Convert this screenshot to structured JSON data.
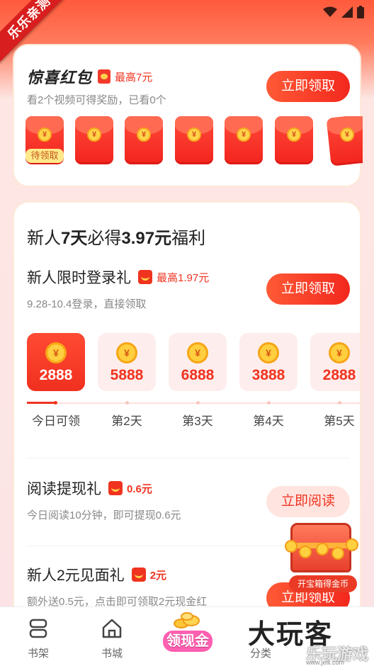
{
  "ribbon": {
    "text": "乐乐亲测"
  },
  "surprise": {
    "title": "惊喜红包",
    "max": "最高7元",
    "subtitle": "看2个视频可得奖励，已看0个",
    "button": "立即领取",
    "pending_tag": "待领取",
    "coin_symbol": "¥"
  },
  "newbie": {
    "title_prefix": "新人",
    "title_days": "7天",
    "title_mid": "必得",
    "title_amount": "3.97元",
    "title_suffix": "福利",
    "login": {
      "title": "新人限时登录礼",
      "max": "最高1.97元",
      "subtitle": "9.28-10.4登录，直接领取",
      "button": "立即领取"
    },
    "days": [
      {
        "amount": "2888",
        "label": "今日可领",
        "active": true
      },
      {
        "amount": "5888",
        "label": "第2天",
        "active": false
      },
      {
        "amount": "6888",
        "label": "第3天",
        "active": false
      },
      {
        "amount": "3888",
        "label": "第4天",
        "active": false
      },
      {
        "amount": "2888",
        "label": "第5天",
        "active": false
      }
    ],
    "read": {
      "title": "阅读提现礼",
      "amount": "0.6元",
      "subtitle": "今日阅读10分钟，即可提现0.6元",
      "button": "立即阅读"
    },
    "meet": {
      "title": "新人2元见面礼",
      "amount": "2元",
      "subtitle": "额外送0.5元，点击即可领取2元现金红",
      "button": "立即领取"
    }
  },
  "chest": {
    "label": "开宝箱得金币"
  },
  "tabbar": {
    "shelf": "书架",
    "store": "书城",
    "cash": "领现金",
    "category": "分类"
  },
  "watermark": {
    "big": "大玩客",
    "small": "乐玩游戏",
    "url": "www.jeili.com"
  },
  "colors": {
    "accent": "#f0331f",
    "background": "#fce4e6"
  }
}
